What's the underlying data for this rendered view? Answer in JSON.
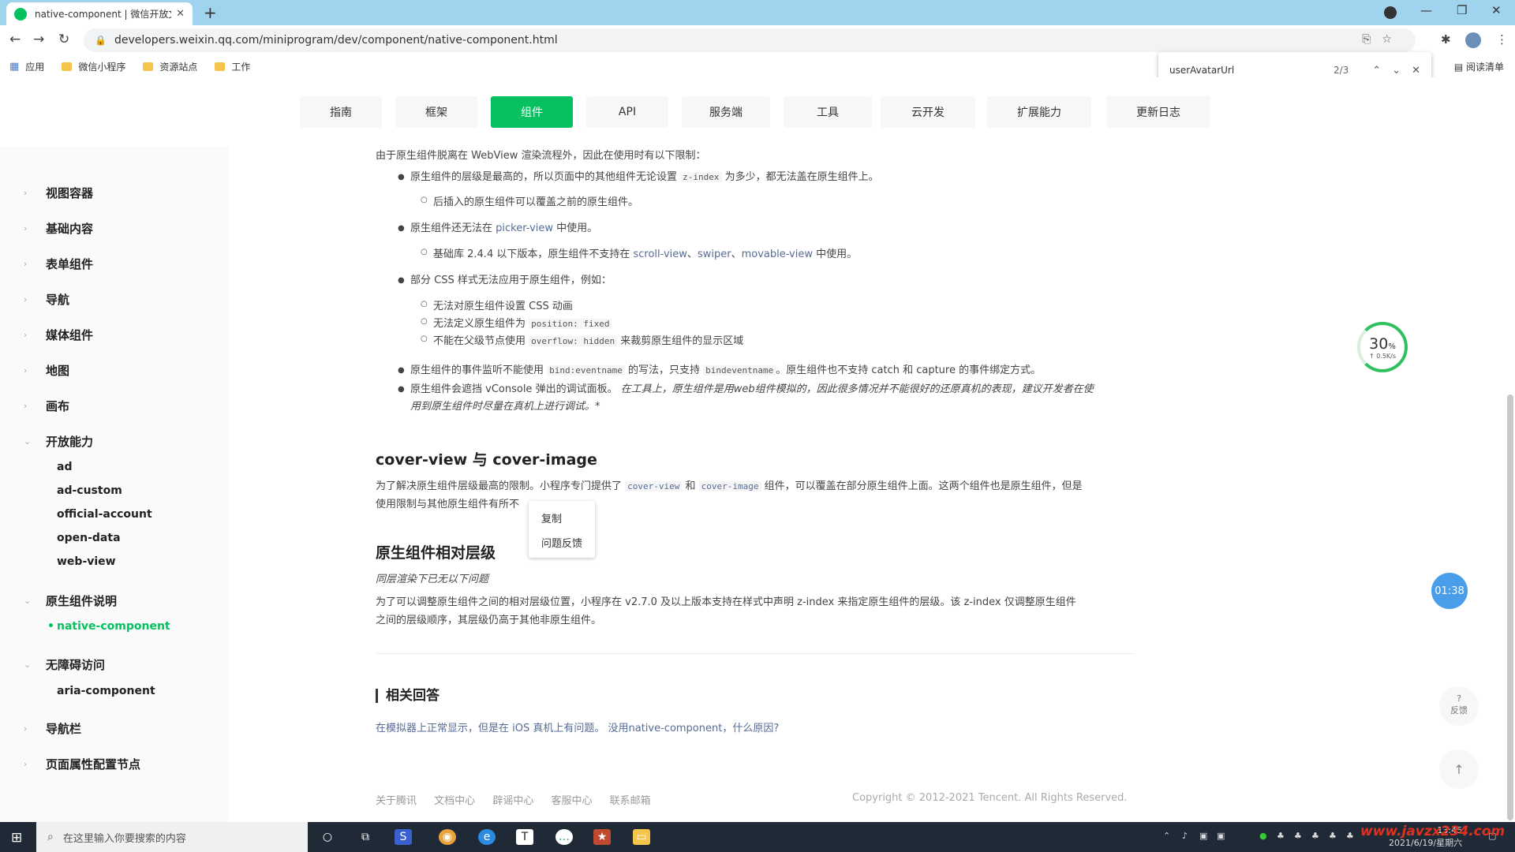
{
  "browser": {
    "tab_title": "native-component | 微信开放文档",
    "url": "developers.weixin.qq.com/miniprogram/dev/component/native-component.html",
    "bookmarks": [
      "应用",
      "微信小程序",
      "资源站点",
      "工作"
    ],
    "reading_list": "阅读清单",
    "find": {
      "query": "userAvatarUrl",
      "count": "2/3"
    }
  },
  "nav": {
    "tabs": [
      "指南",
      "框架",
      "组件",
      "API",
      "服务端",
      "工具",
      "云开发",
      "扩展能力",
      "更新日志"
    ],
    "active": "组件"
  },
  "sidebar": {
    "items": [
      "视图容器",
      "基础内容",
      "表单组件",
      "导航",
      "媒体组件",
      "地图",
      "画布",
      "开放能力"
    ],
    "open_sub": [
      "ad",
      "ad-custom",
      "official-account",
      "open-data",
      "web-view"
    ],
    "native_group": "原生组件说明",
    "native_sub": "native-component",
    "a11y_group": "无障碍访问",
    "a11y_sub": "aria-component",
    "tail": [
      "导航栏",
      "页面属性配置节点"
    ]
  },
  "content": {
    "intro": "由于原生组件脱离在 WebView 渲染流程外，因此在使用时有以下限制：",
    "b1": {
      "pre": "原生组件的层级是最高的，所以页面中的其他组件无论设置 ",
      "code": "z-index",
      "post": " 为多少，都无法盖在原生组件上。"
    },
    "b1_sub": "后插入的原生组件可以覆盖之前的原生组件。",
    "b2": {
      "pre": "原生组件还无法在 ",
      "link": "picker-view",
      "post": " 中使用。"
    },
    "b2_sub": {
      "pre": "基础库 2.4.4 以下版本，原生组件不支持在 ",
      "l1": "scroll-view",
      "sep1": "、",
      "l2": "swiper",
      "sep2": "、",
      "l3": "movable-view",
      "post": " 中使用。"
    },
    "b3": "部分 CSS 样式无法应用于原生组件，例如：",
    "b3_s1": "无法对原生组件设置 CSS 动画",
    "b3_s2": {
      "pre": "无法定义原生组件为 ",
      "code": "position: fixed"
    },
    "b3_s3": {
      "pre": "不能在父级节点使用 ",
      "code": "overflow: hidden",
      "post": " 来裁剪原生组件的显示区域"
    },
    "b4": {
      "pre": "原生组件的事件监听不能使用 ",
      "code1": "bind:eventname",
      "mid": " 的写法，只支持 ",
      "code2": "bindeventname",
      "post": "。原生组件也不支持 catch 和 capture 的事件绑定方式。"
    },
    "b5": {
      "pre": "原生组件会遮挡 vConsole 弹出的调试面板。 ",
      "italic": "在工具上，原生组件是用web组件模拟的，因此很多情况并不能很好的还原真机的表现，建议开发者在使",
      "italic2": "用到原生组件时尽量在真机上进行调试。*"
    },
    "h_cover": "cover-view 与 cover-image",
    "cover_p1": {
      "pre": "为了解决原生组件层级最高的限制。小程序专门提供了 ",
      "code1": "cover-view",
      "mid": " 和 ",
      "code2": "cover-image",
      "post": " 组件，可以覆盖在部分原生组件上面。这两个组件也是原生组件，但是"
    },
    "cover_p2": "使用限制与其他原生组件有所不",
    "h_layer": "原生组件相对层级",
    "layer_note": "同层渲染下已无以下问题",
    "layer_p1": "为了可以调整原生组件之间的相对层级位置，小程序在 v2.7.0 及以上版本支持在样式中声明 z-index 来指定原生组件的层级。该 z-index 仅调整原生组件",
    "layer_p2": "之间的层级顺序，其层级仍高于其他非原生组件。",
    "h_related": "相关回答",
    "related_link": "在模拟器上正常显示，但是在 iOS 真机上有问题。 没用native-component，什么原因?"
  },
  "context_menu": [
    "复制",
    "问题反馈"
  ],
  "footer": {
    "links": [
      "关于腾讯",
      "文档中心",
      "辟谣中心",
      "客服中心",
      "联系邮箱"
    ],
    "copyright": "Copyright © 2012-2021 Tencent. All Rights Reserved."
  },
  "widgets": {
    "speed_pct": "30",
    "speed_unit": "%",
    "speed_rate": "↑ 0.5K/s",
    "timer": "01:38",
    "feedback_q": "?",
    "feedback": "反馈"
  },
  "taskbar": {
    "search_placeholder": "在这里输入你要搜索的内容",
    "time": "13:45",
    "date": "2021/6/19/星期六",
    "watermark": "www.javzx234.com"
  }
}
